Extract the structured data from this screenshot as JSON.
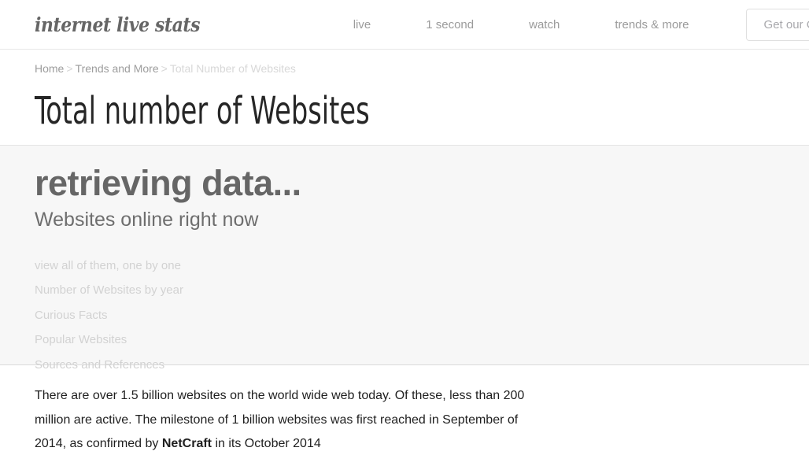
{
  "header": {
    "logo_text": "internet live stats",
    "nav": [
      {
        "label": "live"
      },
      {
        "label": "1 second"
      },
      {
        "label": "watch"
      },
      {
        "label": "trends & more"
      }
    ],
    "cta_label": "Get our Counters!"
  },
  "breadcrumb": {
    "home": "Home",
    "sep1": ">",
    "parent": "Trends and More",
    "sep2": ">",
    "current": "Total Number of Websites"
  },
  "page": {
    "title": "Total number of Websites"
  },
  "counter": {
    "value": "retrieving data...",
    "caption": "Websites online right now",
    "links": [
      {
        "label": "view all of them, one by one"
      },
      {
        "label": "Number of Websites by year"
      },
      {
        "label": "Curious Facts"
      },
      {
        "label": "Popular Websites"
      },
      {
        "label": "Sources and References"
      }
    ]
  },
  "article": {
    "paragraph_part1": "There are over 1.5 billion websites on the world wide web today. Of these, less than 200 million are active. The milestone of 1 billion websites was first reached in September of 2014, as confirmed by ",
    "paragraph_bold": "NetCraft",
    "paragraph_part2": " in its October 2014"
  },
  "colors": {
    "band_background": "#f7f7f7",
    "page_background": "#ffffff",
    "muted_text": "#d2d2d2",
    "nav_text": "#9b9b9b",
    "heading_text": "#262626"
  }
}
